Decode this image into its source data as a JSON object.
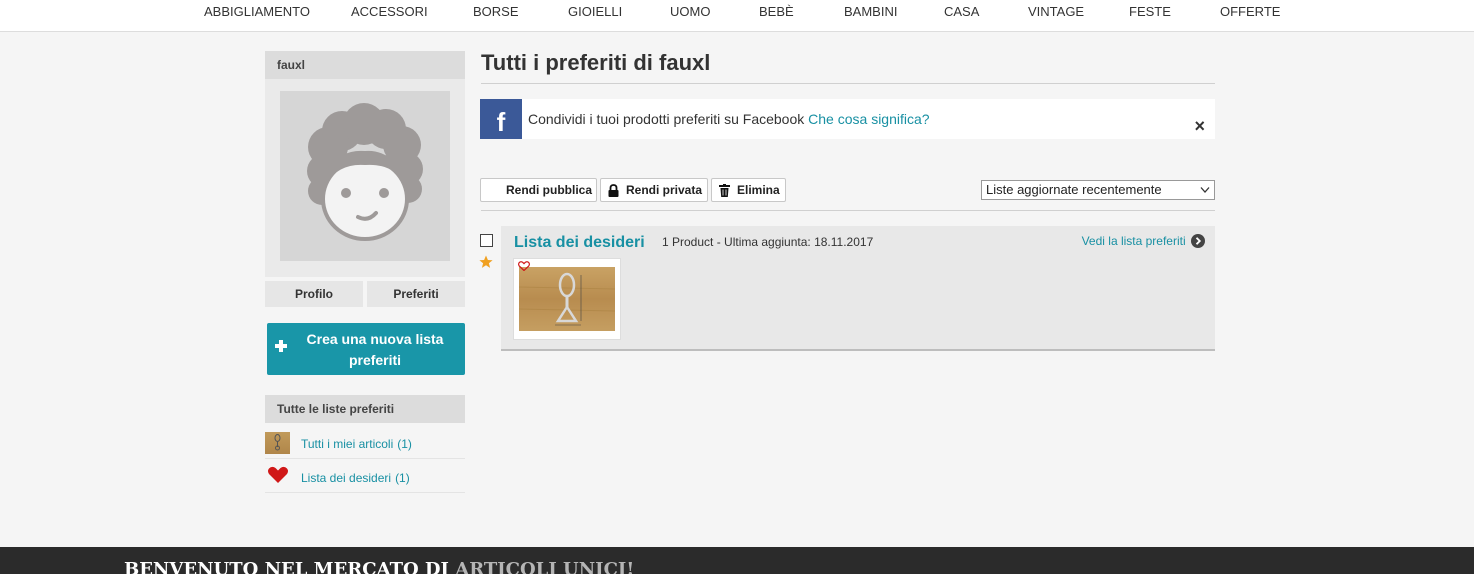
{
  "nav": {
    "items": [
      "ABBIGLIAMENTO",
      "ACCESSORI",
      "BORSE",
      "GIOIELLI",
      "UOMO",
      "BEBÈ",
      "BAMBINI",
      "CASA",
      "VINTAGE",
      "FESTE",
      "OFFERTE"
    ]
  },
  "sidebar": {
    "username": "fauxl",
    "tabs": [
      "Profilo",
      "Preferiti"
    ],
    "create_button": "Crea una nuova lista preferiti",
    "lists_heading": "Tutte le liste preferiti",
    "lists": [
      {
        "label": "Tutti i miei articoli",
        "count": "(1)",
        "icon": "thumbnail"
      },
      {
        "label": "Lista dei desideri",
        "count": "(1)",
        "icon": "heart-icon"
      }
    ]
  },
  "main": {
    "title": "Tutti i preferiti di fauxl",
    "facebook": {
      "logo": "f",
      "text": "Condividi i tuoi prodotti preferiti su Facebook",
      "link": "Che cosa significa?",
      "close": "×"
    },
    "toolbar": {
      "public": "Rendi pubblica",
      "private": "Rendi privata",
      "delete": "Elimina"
    },
    "sort": {
      "selected": "Liste aggiornate recentemente"
    },
    "list_card": {
      "title": "Lista dei desideri",
      "meta": "1 Product - Ultima aggiunta: 18.11.2017",
      "view_link": "Vedi la lista preferiti"
    }
  },
  "footer": {
    "text": "BENVENUTO NEL MERCATO DI",
    "accent": "ARTICOLI UNICI!"
  },
  "colors": {
    "accent": "#1996a8",
    "link": "#1890a3",
    "facebook": "#3b5998",
    "footer_bg": "#2b2b2b",
    "star": "#f0a020",
    "heart": "#d01818"
  }
}
